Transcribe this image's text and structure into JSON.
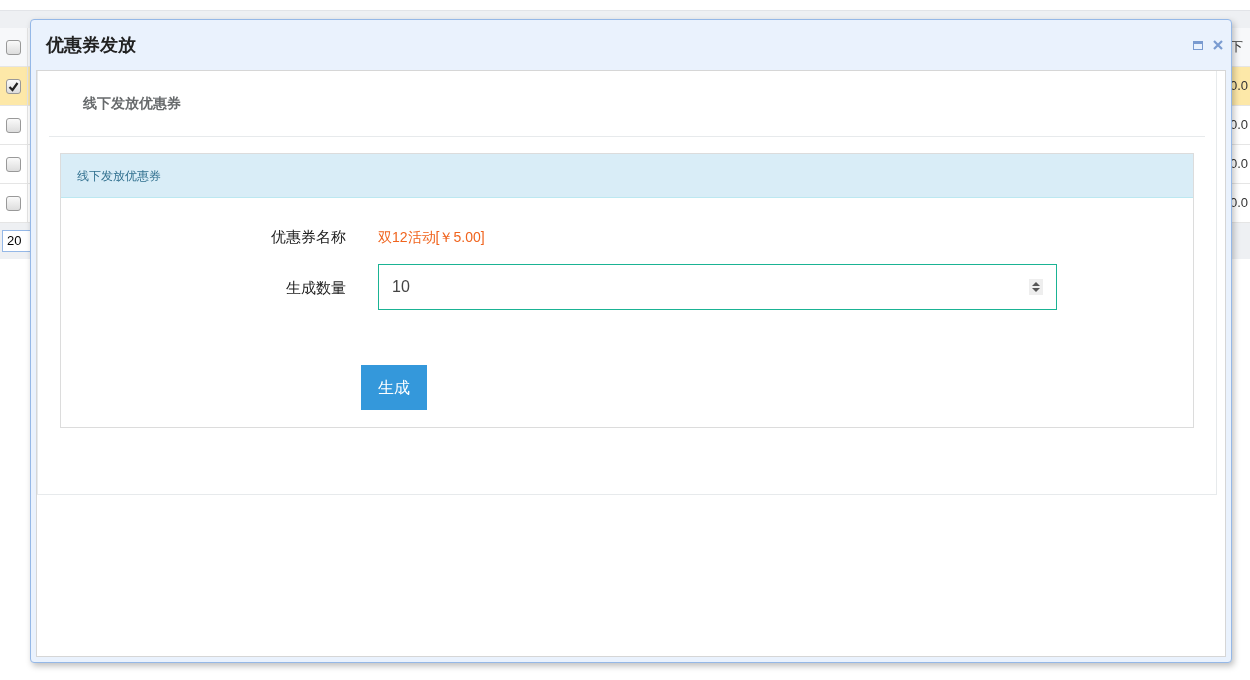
{
  "background_table": {
    "header": {
      "checked": false,
      "column_last": "下"
    },
    "rows": [
      {
        "checked": true,
        "selected": true,
        "column_last": "0.0"
      },
      {
        "checked": false,
        "selected": false,
        "column_last": "0.0"
      },
      {
        "checked": false,
        "selected": false,
        "column_last": "0.0"
      },
      {
        "checked": false,
        "selected": false,
        "column_last": "0.0"
      }
    ],
    "page_size": "20"
  },
  "dialog": {
    "title": "优惠券发放",
    "page_title": "线下发放优惠券",
    "panel_title": "线下发放优惠券",
    "fields": [
      {
        "kind": "text",
        "label": "优惠券名称",
        "value": "双12活动[￥5.00]"
      },
      {
        "kind": "number",
        "label": "生成数量",
        "value": "10"
      }
    ],
    "submit": "生成"
  }
}
